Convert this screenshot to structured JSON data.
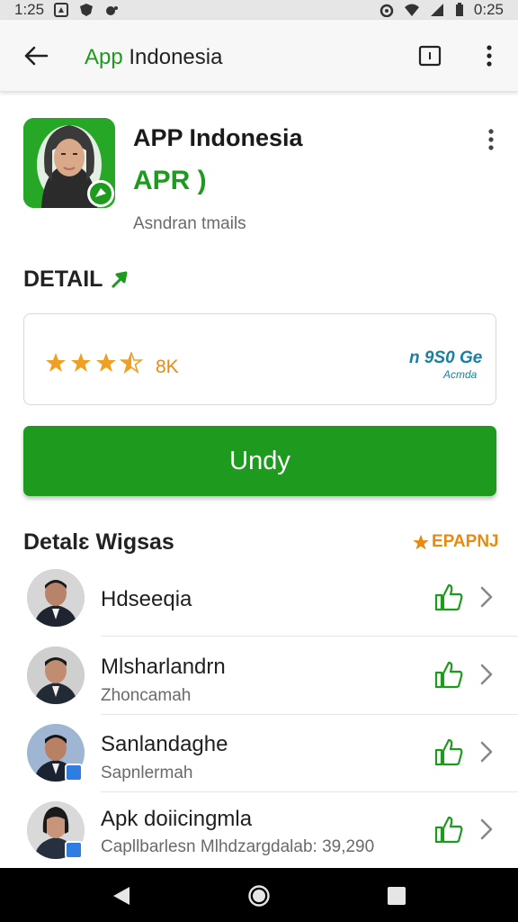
{
  "status_bar": {
    "time": "1:25",
    "battery": "0:25"
  },
  "app_bar": {
    "title_part1": "App",
    "title_part2": " Indonesia"
  },
  "app": {
    "name": "APP Indonesia",
    "subtitle": "APR )",
    "developer": "Asndran tmails"
  },
  "detail": {
    "heading": "DETAIL"
  },
  "rating_card": {
    "stars": 3.5,
    "count": "8K",
    "badge_top": "n 9S0 Ge",
    "badge_bottom": "Acmda"
  },
  "install_button": {
    "label": "Undy"
  },
  "section": {
    "title": "Detalɛ Wigsas",
    "action": "EPAPNJ"
  },
  "list": [
    {
      "name": "Hdseeqia",
      "sub": ""
    },
    {
      "name": "Mlsharlandrn",
      "sub": "Zhoncamah"
    },
    {
      "name": "Sanlandaghe",
      "sub": "Sapnlermah"
    },
    {
      "name": "Apk doiicingmla",
      "sub": "Capllbarlesn Mlhdzargdalab: 39,290"
    }
  ],
  "colors": {
    "accent_green": "#1e9a1e",
    "star_orange": "#f0a020",
    "badge_teal": "#1a7fa0"
  },
  "icons": {
    "back": "arrow-left-icon",
    "window": "window-icon",
    "menu": "more-vert-icon",
    "like": "thumbs-up-icon",
    "chevron": "chevron-right-icon"
  }
}
